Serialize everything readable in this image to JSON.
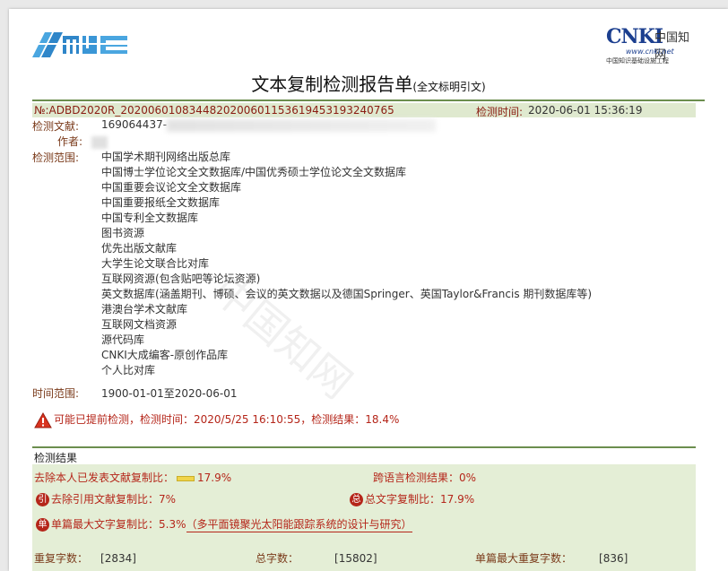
{
  "header": {
    "logo_right_mark": "CNKI",
    "logo_right_chars": "中国知网",
    "logo_right_url": "www.cnki.net",
    "logo_right_sub": "中国知识基础设施工程",
    "title": "文本复制检测报告单",
    "title_suffix": "(全文标明引文)"
  },
  "report": {
    "id": "№:ADBD2020R_20200601083448202006011536194531932407​65",
    "detect_time_label": "检测时间:",
    "detect_time": "2020-06-01 15:36:19",
    "doc_label": "检测文献:",
    "doc_value": "169064437-",
    "author_label": "作者:",
    "scope_label": "检测范围:",
    "scope_items": [
      "中国学术期刊网络出版总库",
      "中国博士学位论文全文数据库/中国优秀硕士学位论文全文数据库",
      "中国重要会议论文全文数据库",
      "中国重要报纸全文数据库",
      "中国专利全文数据库",
      "图书资源",
      "优先出版文献库",
      "大学生论文联合比对库",
      "互联网资源(包含贴吧等论坛资源)",
      "英文数据库(涵盖期刊、博硕、会议的英文数据以及德国Springer、英国Taylor&Francis 期刊数据库等)",
      "港澳台学术文献库",
      "互联网文档资源",
      "源代码库",
      "CNKI大成编客-原创作品库",
      "个人比对库"
    ],
    "time_range_label": "时间范围:",
    "time_range": "1900-01-01至2020-06-01",
    "warning": "可能已提前检测，检测时间：2020/5/25 16:10:55，检测结果：18.4%"
  },
  "results": {
    "section_title": "检测结果",
    "exclude_self_label": "去除本人已发表文献复制比：",
    "exclude_self_value": "17.9%",
    "cross_lang_label": "跨语言检测结果：",
    "cross_lang_value": "0%",
    "exclude_ref_badge": "引",
    "exclude_ref_label": "去除引用文献复制比：",
    "exclude_ref_value": "7%",
    "total_badge": "总",
    "total_label": "总文字复制比：",
    "total_value": "17.9%",
    "single_badge": "单",
    "single_label": "单篇最大文字复制比：",
    "single_value": "5.3%",
    "single_paper": "（多平面镜聚光太阳能跟踪系统的设计与研究）",
    "dup_chars_label": "重复字数：",
    "dup_chars_value": "[2834]",
    "total_chars_label": "总字数：",
    "total_chars_value": "[15802]",
    "single_max_dup_label": "单篇最大重复字数：",
    "single_max_dup_value": "[836]"
  },
  "colors": {
    "accent_green": "#6b8e4e",
    "header_bar_bg": "#dfe9cf",
    "result_bg": "#e4eed6",
    "alert_red": "#b5261a"
  }
}
